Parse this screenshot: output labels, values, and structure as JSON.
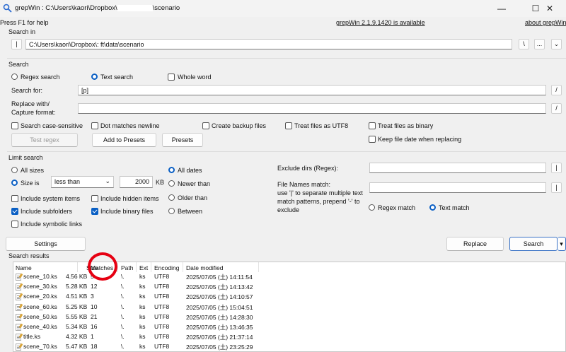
{
  "titlebar": {
    "title_prefix": "grepWin : C:\\Users\\kaori\\Dropbox\\",
    "title_suffix": "\\scenario",
    "minimize": "—",
    "maximize": "☐",
    "close": "✕"
  },
  "help_text": "Press F1 for help",
  "update_link": "grepWin 2.1.9.1420 is available",
  "about_link": "about grepWin",
  "search_in": {
    "label": "Search in",
    "path": "C:\\Users\\kaori\\Dropbox\\:                ft\\data\\scenario",
    "pipe_btn": "|",
    "backslash_btn": "\\",
    "browse_btn": "...",
    "menu_btn": "⌄"
  },
  "search": {
    "section_label": "Search",
    "regex_label": "Regex search",
    "text_label": "Text search",
    "whole_word_label": "Whole word",
    "search_for_label": "Search for:",
    "search_for_value": "[p]",
    "replace_label_1": "Replace with/",
    "replace_label_2": "Capture format:",
    "replace_value": "",
    "slash_btn": "/",
    "case_sensitive": "Search case-sensitive",
    "dot_newline": "Dot matches newline",
    "create_backup": "Create backup files",
    "treat_utf8": "Treat files as UTF8",
    "treat_binary": "Treat files as binary",
    "keep_date": "Keep file date when replacing",
    "test_regex": "Test regex",
    "add_presets": "Add to Presets",
    "presets": "Presets"
  },
  "limit": {
    "section_label": "Limit search",
    "all_sizes": "All sizes",
    "size_is": "Size is",
    "size_op": "less than",
    "size_value": "2000",
    "size_unit": "KB",
    "all_dates": "All dates",
    "newer_than": "Newer than",
    "older_than": "Older than",
    "between": "Between",
    "system_items": "Include system items",
    "hidden_items": "Include hidden items",
    "subfolders": "Include subfolders",
    "binary_files": "Include binary files",
    "symbolic_links": "Include symbolic links",
    "exclude_dirs_label": "Exclude dirs (Regex):",
    "exclude_dirs_value": "",
    "file_names_label_1": "File Names match:",
    "file_names_label_2": "use '|' to separate multiple text",
    "file_names_label_3": "match patterns, prepend '-' to",
    "file_names_label_4": "exclude",
    "file_names_value": "",
    "pipe_btn": "|",
    "regex_match": "Regex match",
    "text_match": "Text match"
  },
  "actions": {
    "settings": "Settings",
    "replace": "Replace",
    "search": "Search",
    "split": "▾"
  },
  "results": {
    "label": "Search results",
    "columns": [
      "Name",
      "Size",
      "Matches",
      "Path",
      "Ext",
      "Encoding",
      "Date modified"
    ],
    "rows": [
      [
        "scene_10.ks",
        "4.56 KB",
        "5",
        "\\.",
        "ks",
        "UTF8",
        "2025/07/05 (土) 14:11:54"
      ],
      [
        "scene_30.ks",
        "5.28 KB",
        "12",
        "\\.",
        "ks",
        "UTF8",
        "2025/07/05 (土) 14:13:42"
      ],
      [
        "scene_20.ks",
        "4.51 KB",
        "3",
        "\\.",
        "ks",
        "UTF8",
        "2025/07/05 (土) 14:10:57"
      ],
      [
        "scene_60.ks",
        "5.25 KB",
        "10",
        "\\.",
        "ks",
        "UTF8",
        "2025/07/05 (土) 15:04:51"
      ],
      [
        "scene_50.ks",
        "5.55 KB",
        "21",
        "\\.",
        "ks",
        "UTF8",
        "2025/07/05 (土) 14:28:30"
      ],
      [
        "scene_40.ks",
        "5.34 KB",
        "16",
        "\\.",
        "ks",
        "UTF8",
        "2025/07/05 (土) 13:46:35"
      ],
      [
        "title.ks",
        "4.32 KB",
        "1",
        "\\.",
        "ks",
        "UTF8",
        "2025/07/05 (土) 21:37:14"
      ],
      [
        "scene_70.ks",
        "5.47 KB",
        "18",
        "\\.",
        "ks",
        "UTF8",
        "2025/07/05 (土) 23:25:29"
      ]
    ]
  },
  "colors": {
    "accent": "#0a5fc4",
    "annotation": "#e60012"
  }
}
